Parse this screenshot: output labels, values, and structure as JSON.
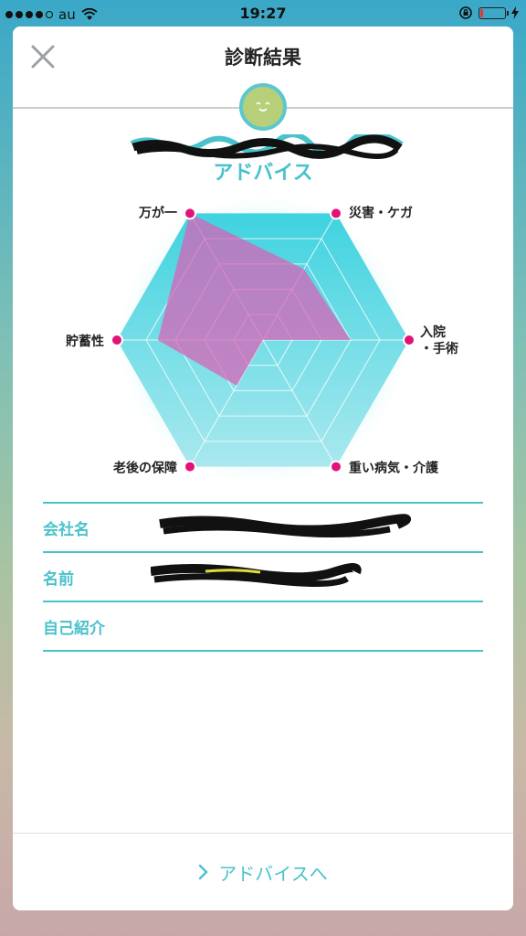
{
  "status": {
    "carrier": "au",
    "time": "19:27",
    "signal_bars": 4,
    "battery_level": 0.1
  },
  "header": {
    "title": "診断結果",
    "close_icon": "close-icon"
  },
  "result": {
    "subtitle": "アドバイス"
  },
  "chart_data": {
    "type": "radar",
    "axes": [
      "万が一",
      "災害・ケガ",
      "入院・手術",
      "重い病気・介護",
      "老後の保障",
      "貯蓄性"
    ],
    "levels": 5,
    "values": [
      5,
      2.8,
      3.0,
      0,
      1.8,
      3.6
    ],
    "max": 5,
    "colors": {
      "hexagon_top": "#3fd3e0",
      "hexagon_bottom": "#a9e8ee",
      "polygon": "#d95fb6",
      "dot": "#e3127a"
    }
  },
  "info": {
    "rows": [
      {
        "label": "会社名"
      },
      {
        "label": "名前"
      },
      {
        "label": "自己紹介"
      }
    ]
  },
  "footer": {
    "advice_label": "アドバイスへ"
  },
  "colors": {
    "accent": "#49c2cd"
  }
}
